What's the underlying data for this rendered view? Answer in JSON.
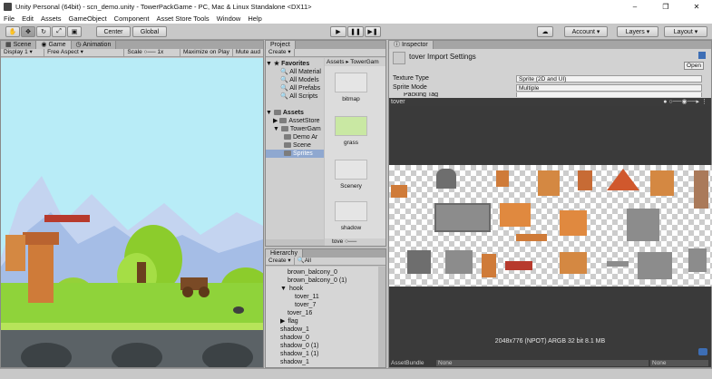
{
  "window": {
    "title": "Unity Personal (64bit) - scn_demo.unity - TowerPackGame - PC, Mac & Linux Standalone <DX11>",
    "minimize": "–",
    "maximize": "❐",
    "close": "✕"
  },
  "menu": [
    "File",
    "Edit",
    "Assets",
    "GameObject",
    "Component",
    "Asset Store Tools",
    "Window",
    "Help"
  ],
  "toolbar": {
    "pivot": "Center",
    "space": "Global",
    "account": "Account",
    "layers": "Layers",
    "layout": "Layout"
  },
  "scene_panel": {
    "tabs": [
      "Scene",
      "Game",
      "Animation"
    ],
    "display": "Display 1",
    "aspect": "Free Aspect",
    "scale_label": "Scale",
    "scale_value": "1x",
    "maximize": "Maximize on Play",
    "mute": "Mute aud"
  },
  "project_panel": {
    "tab": "Project",
    "create": "Create",
    "favorites": "Favorites",
    "fav_items": [
      "All Material",
      "All Models",
      "All Prefabs",
      "All Scripts"
    ],
    "assets_root": "Assets",
    "asset_items": [
      "AssetStore",
      "TowerGam",
      "Demo Ar",
      "Scene",
      "Sprites"
    ],
    "breadcrumb": [
      "Assets",
      "TowerGam"
    ],
    "tiles": [
      "bitmap",
      "grass",
      "Scenery",
      "shadow"
    ],
    "footer": "tove"
  },
  "hierarchy_panel": {
    "tab": "Hierarchy",
    "create": "Create",
    "search": "All",
    "rows": [
      {
        "label": "brown_balcony_0",
        "indent": 0
      },
      {
        "label": "brown_balcony_0 (1)",
        "indent": 0
      },
      {
        "label": "hook",
        "indent": 0,
        "arrow": "▼"
      },
      {
        "label": "tover_11",
        "indent": 1
      },
      {
        "label": "tover_7",
        "indent": 1
      },
      {
        "label": "tover_16",
        "indent": 0
      },
      {
        "label": "flag",
        "indent": 0,
        "arrow": "▶"
      },
      {
        "label": "shadow_1",
        "indent": -1
      },
      {
        "label": "shadow_0",
        "indent": -1
      },
      {
        "label": "shadow_0 (1)",
        "indent": -1
      },
      {
        "label": "shadow_1 (1)",
        "indent": -1
      },
      {
        "label": "shadow_1",
        "indent": -1
      }
    ]
  },
  "inspector": {
    "tab": "Inspector",
    "title": "tover Import Settings",
    "open": "Open",
    "fields": [
      {
        "key": "Texture Type",
        "value": "Sprite (2D and UI)"
      },
      {
        "key": "Sprite Mode",
        "value": "Multiple"
      },
      {
        "key": "Packing Tag",
        "value": ""
      }
    ],
    "preview_name": "tover",
    "info": "2048x776 (NPOT)  ARGB 32 bit   8.1 MB",
    "assetbundle_label": "AssetBundle",
    "bundle_value": "None",
    "variant_value": "None"
  },
  "colors": {
    "sky": "#b8ecf7",
    "grass": "#8fd33a",
    "ground": "#5b6266",
    "accent": "#3d6eb5"
  }
}
